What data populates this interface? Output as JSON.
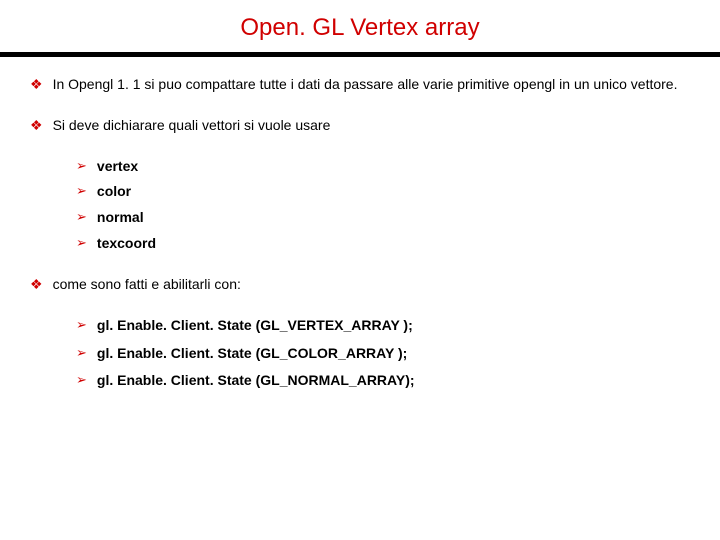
{
  "title": "Open. GL Vertex array",
  "bullets": [
    {
      "text": "In Opengl 1. 1 si puo compattare tutte i dati da passare alle varie primitive opengl in un unico vettore."
    },
    {
      "text": "Si deve dichiarare quali vettori si vuole usare",
      "sub": [
        {
          "text": "vertex"
        },
        {
          "text": "color"
        },
        {
          "text": "normal"
        },
        {
          "text": "texcoord"
        }
      ]
    },
    {
      "text": "come sono fatti e abilitarli con:",
      "sub": [
        {
          "text": "gl. Enable. Client. State (GL_VERTEX_ARRAY );"
        },
        {
          "text": "gl. Enable. Client. State (GL_COLOR_ARRAY  );"
        },
        {
          "text": "gl. Enable. Client. State (GL_NORMAL_ARRAY);"
        }
      ]
    }
  ],
  "markers": {
    "diamond": "❖",
    "arrow": "➢"
  }
}
